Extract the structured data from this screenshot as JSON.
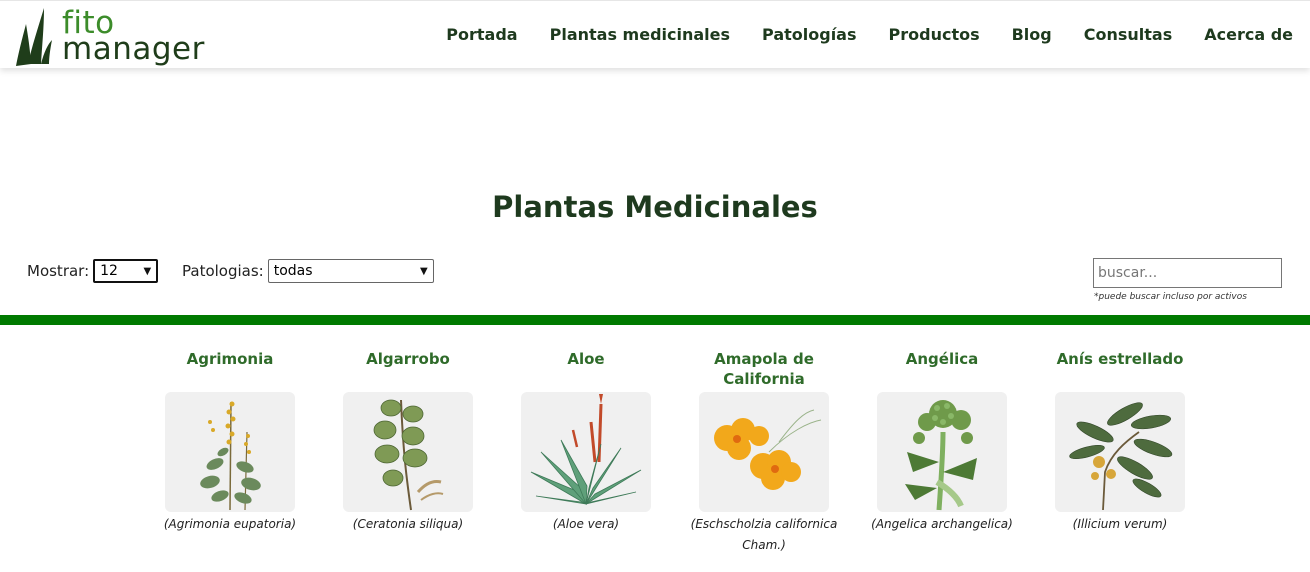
{
  "brand": {
    "line1": "fito",
    "line2": "manager"
  },
  "nav": [
    {
      "label": "Portada"
    },
    {
      "label": "Plantas medicinales"
    },
    {
      "label": "Patologías"
    },
    {
      "label": "Productos"
    },
    {
      "label": "Blog"
    },
    {
      "label": "Consultas"
    },
    {
      "label": "Acerca de"
    }
  ],
  "page": {
    "title": "Plantas Medicinales"
  },
  "filters": {
    "show_label": "Mostrar:",
    "show_value": "12",
    "pathology_label": "Patologias:",
    "pathology_value": "todas"
  },
  "search": {
    "placeholder": "buscar...",
    "hint": "*puede buscar incluso por activos"
  },
  "plants": [
    {
      "name": "Agrimonia",
      "scientific": "(Agrimonia eupatoria)",
      "illustration": "agrimonia-illustration"
    },
    {
      "name": "Algarrobo",
      "scientific": "(Ceratonia siliqua)",
      "illustration": "carob-illustration"
    },
    {
      "name": "Aloe",
      "scientific": "(Aloe vera)",
      "illustration": "aloe-illustration"
    },
    {
      "name": "Amapola de California",
      "scientific": "(Eschscholzia californica Cham.)",
      "illustration": "california-poppy-illustration"
    },
    {
      "name": "Angélica",
      "scientific": "(Angelica archangelica)",
      "illustration": "angelica-illustration"
    },
    {
      "name": "Anís estrellado",
      "scientific": "(Illicium verum)",
      "illustration": "star-anise-illustration"
    }
  ],
  "colors": {
    "brand_green": "#3c8c2a",
    "dark_green": "#1e3a1e",
    "divider_green": "#007a00",
    "plant_name_green": "#2f6b2a",
    "image_bg": "#f0f0f0"
  }
}
